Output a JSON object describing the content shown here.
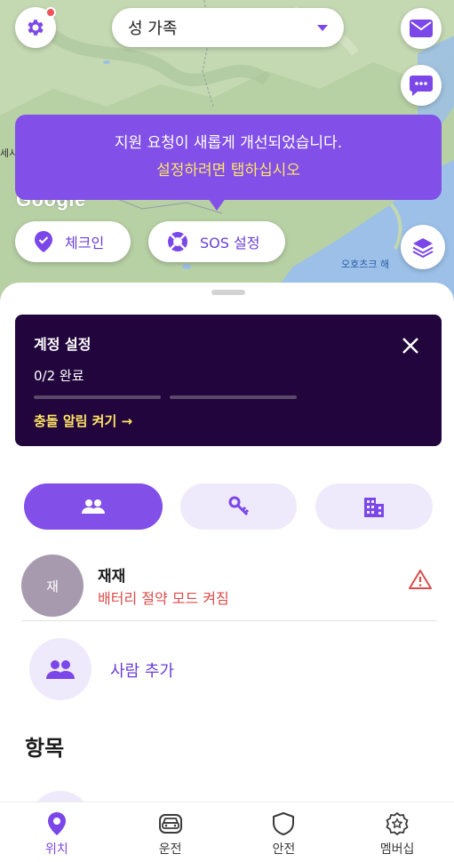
{
  "header": {
    "circle_name": "성 가족"
  },
  "map": {
    "watermark": "Google",
    "label_sea": "오호츠크 해",
    "label_left": "세시"
  },
  "tooltip": {
    "line1": "지원 요청이 새롭게 개선되었습니다.",
    "line2": "설정하려면 탭하십시오"
  },
  "map_buttons": {
    "checkin_label": "체크인",
    "sos_label": "SOS 설정"
  },
  "setup_card": {
    "title": "계정 설정",
    "progress_text": "0/2 완료",
    "progress_completed": 0,
    "progress_total": 2,
    "action_text": "충돌 알림 켜기 →"
  },
  "tabs": [
    {
      "icon": "people-icon",
      "active": true
    },
    {
      "icon": "keys-icon",
      "active": false
    },
    {
      "icon": "building-icon",
      "active": false
    }
  ],
  "members": [
    {
      "initial": "재",
      "name": "재재",
      "status": "배터리 절약 모드 켜짐"
    }
  ],
  "add_person_label": "사람 추가",
  "items_section_title": "항목",
  "bottom_nav": [
    {
      "label": "위치",
      "icon": "location-pin-icon",
      "active": true
    },
    {
      "label": "운전",
      "icon": "car-icon",
      "active": false
    },
    {
      "label": "안전",
      "icon": "shield-icon",
      "active": false
    },
    {
      "label": "멤버십",
      "icon": "star-badge-icon",
      "active": false
    }
  ],
  "colors": {
    "accent": "#8250e8",
    "accent_dark": "#22053d",
    "highlight": "#ffe566",
    "warning": "#dc4b4b"
  }
}
